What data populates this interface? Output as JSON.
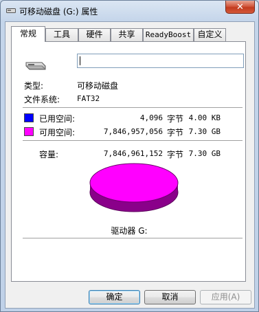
{
  "window": {
    "title": "可移动磁盘 (G:) 属性",
    "close_label": "✕"
  },
  "tabs": [
    {
      "label": "常规"
    },
    {
      "label": "工具"
    },
    {
      "label": "硬件"
    },
    {
      "label": "共享"
    },
    {
      "label": "ReadyBoost"
    },
    {
      "label": "自定义"
    }
  ],
  "general": {
    "name_value": "",
    "type_label": "类型:",
    "type_value": "可移动磁盘",
    "fs_label": "文件系统:",
    "fs_value": "FAT32",
    "used": {
      "label": "已用空间:",
      "bytes": "4,096",
      "unit": "字节",
      "size": "4.00 KB",
      "color": "#0000ff"
    },
    "free": {
      "label": "可用空间:",
      "bytes": "7,846,957,056",
      "unit": "字节",
      "size": "7.30 GB",
      "color": "#ff00ff"
    },
    "capacity": {
      "label": "容量:",
      "bytes": "7,846,961,152",
      "unit": "字节",
      "size": "7.30 GB"
    },
    "drive_label": "驱动器 G:"
  },
  "buttons": {
    "ok": "确定",
    "cancel": "取消",
    "apply": "应用(A)"
  },
  "icons": {
    "window": "drive-icon",
    "drive": "removable-drive-icon"
  }
}
